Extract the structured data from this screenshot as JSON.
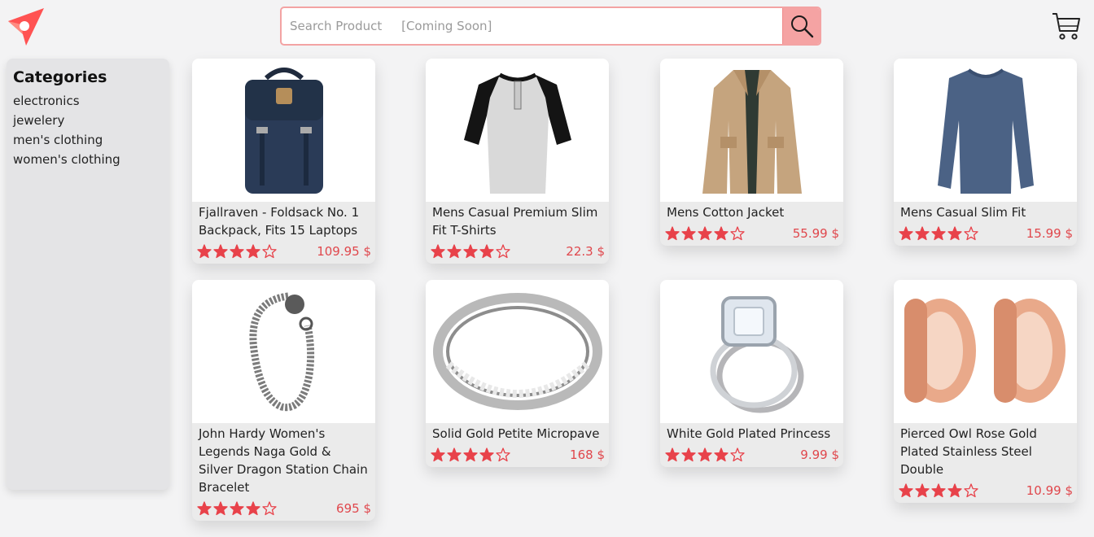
{
  "header": {
    "search_placeholder": "Search Product     [Coming Soon]",
    "brand_color": "#ff5c5c"
  },
  "sidebar": {
    "title": "Categories",
    "items": [
      {
        "label": "electronics"
      },
      {
        "label": "jewelery"
      },
      {
        "label": "men's clothing"
      },
      {
        "label": "women's clothing"
      }
    ]
  },
  "products": [
    {
      "title": "Fjallraven - Foldsack No. 1 Backpack, Fits 15 Laptops",
      "rating": 4,
      "price": "109.95 $",
      "image": "backpack-image"
    },
    {
      "title": "Mens Casual Premium Slim Fit T-Shirts",
      "rating": 4,
      "price": "22.3 $",
      "image": "tshirt-image"
    },
    {
      "title": "Mens Cotton Jacket",
      "rating": 4,
      "price": "55.99 $",
      "image": "jacket-image"
    },
    {
      "title": "Mens Casual Slim Fit",
      "rating": 4,
      "price": "15.99 $",
      "image": "long-sleeve-image"
    },
    {
      "title": "John Hardy Women's Legends Naga Gold & Silver Dragon Station Chain Bracelet",
      "rating": 4,
      "price": "695 $",
      "image": "bracelet-image"
    },
    {
      "title": "Solid Gold Petite Micropave",
      "rating": 4,
      "price": "168 $",
      "image": "ring-image"
    },
    {
      "title": "White Gold Plated Princess",
      "rating": 4,
      "price": "9.99 $",
      "image": "diamond-ring-image"
    },
    {
      "title": "Pierced Owl Rose Gold Plated Stainless Steel Double",
      "rating": 4,
      "price": "10.99 $",
      "image": "plugs-image"
    }
  ],
  "colors": {
    "accent": "#e0474c",
    "star": "#e8424a",
    "search_button": "#f5a3a3"
  }
}
